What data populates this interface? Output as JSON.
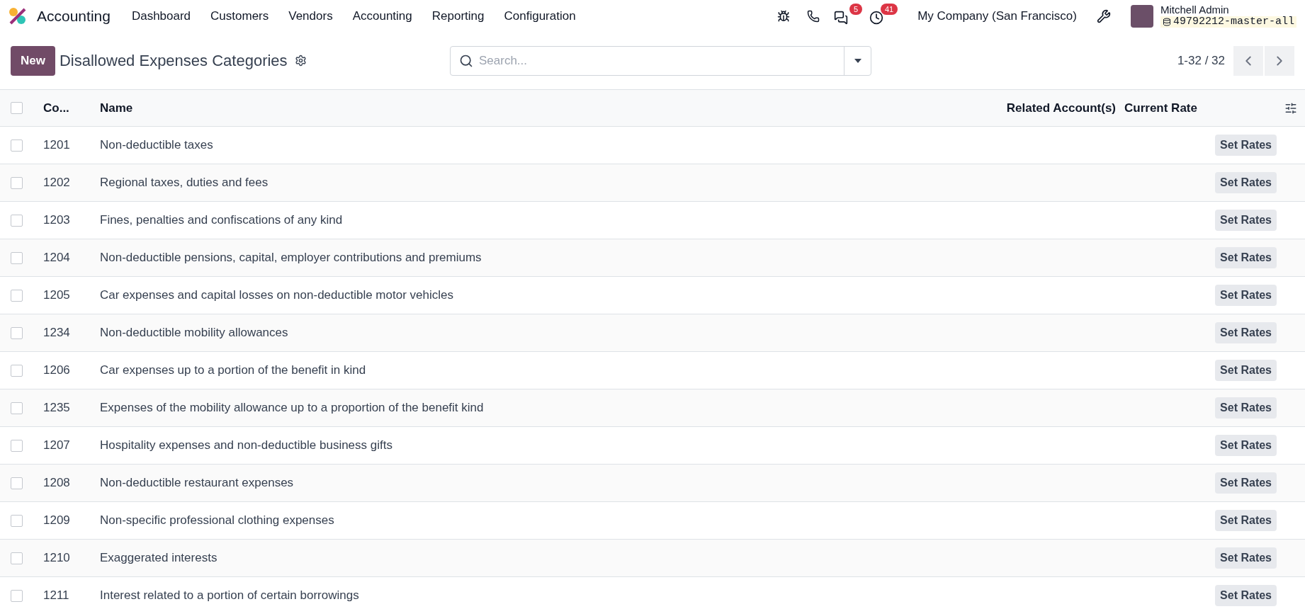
{
  "navbar": {
    "app_name": "Accounting",
    "menu": [
      "Dashboard",
      "Customers",
      "Vendors",
      "Accounting",
      "Reporting",
      "Configuration"
    ],
    "messages_badge": "5",
    "activities_badge": "41",
    "company": "My Company (San Francisco)",
    "user_name": "Mitchell Admin",
    "database": "49792212-master-all"
  },
  "control_panel": {
    "new_button": "New",
    "title": "Disallowed Expenses Categories",
    "search": {
      "placeholder": "Search..."
    },
    "pager": "1-32 / 32"
  },
  "table": {
    "select_all_checked": false,
    "columns": [
      "Co...",
      "Name",
      "Related Account(s)",
      "Current Rate"
    ],
    "rows": [
      {
        "code": "1201",
        "name": "Non-deductible taxes",
        "action": "Set Rates",
        "checked": false
      },
      {
        "code": "1202",
        "name": "Regional taxes, duties and fees",
        "action": "Set Rates",
        "checked": false
      },
      {
        "code": "1203",
        "name": "Fines, penalties and confiscations of any kind",
        "action": "Set Rates",
        "checked": false
      },
      {
        "code": "1204",
        "name": "Non-deductible pensions, capital, employer contributions and premiums",
        "action": "Set Rates",
        "checked": false
      },
      {
        "code": "1205",
        "name": "Car expenses and capital losses on non-deductible motor vehicles",
        "action": "Set Rates",
        "checked": false
      },
      {
        "code": "1234",
        "name": "Non-deductible mobility allowances",
        "action": "Set Rates",
        "checked": false
      },
      {
        "code": "1206",
        "name": "Car expenses up to a portion of the benefit in kind",
        "action": "Set Rates",
        "checked": false
      },
      {
        "code": "1235",
        "name": "Expenses of the mobility allowance up to a proportion of the benefit kind",
        "action": "Set Rates",
        "checked": false
      },
      {
        "code": "1207",
        "name": "Hospitality expenses and non-deductible business gifts",
        "action": "Set Rates",
        "checked": false
      },
      {
        "code": "1208",
        "name": "Non-deductible restaurant expenses",
        "action": "Set Rates",
        "checked": false
      },
      {
        "code": "1209",
        "name": "Non-specific professional clothing expenses",
        "action": "Set Rates",
        "checked": false
      },
      {
        "code": "1210",
        "name": "Exaggerated interests",
        "action": "Set Rates",
        "checked": false
      },
      {
        "code": "1211",
        "name": "Interest related to a portion of certain borrowings",
        "action": "Set Rates",
        "checked": false
      }
    ]
  }
}
